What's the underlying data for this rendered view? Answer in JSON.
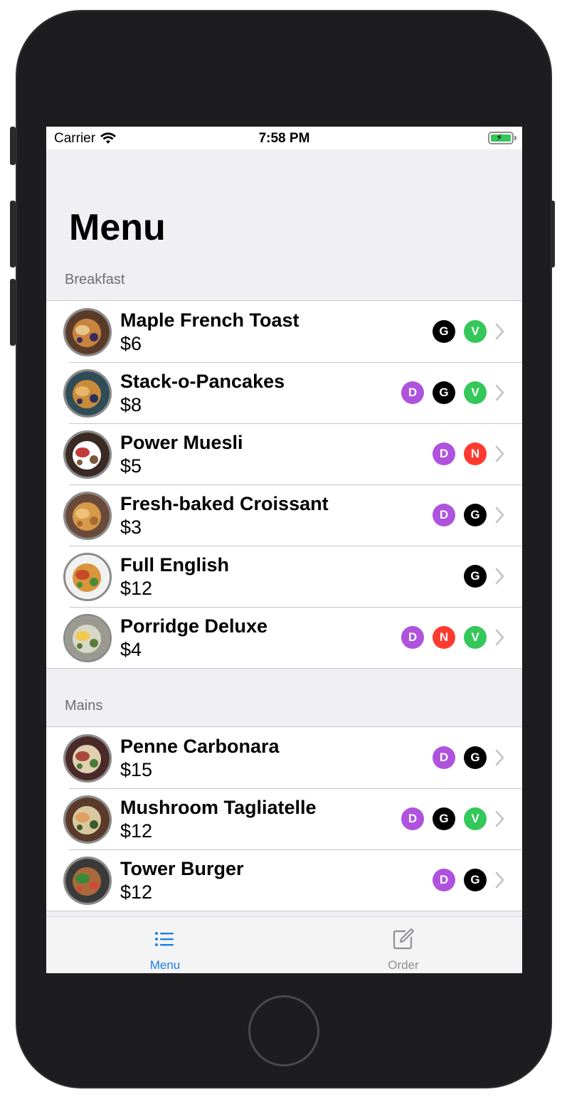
{
  "status_bar": {
    "carrier": "Carrier",
    "time": "7:58 PM"
  },
  "title": "Menu",
  "colors": {
    "accent": "#1a7fe8",
    "tag_D": "#af52de",
    "tag_G": "#000000",
    "tag_N": "#ff3b30",
    "tag_V": "#34c759"
  },
  "sections": [
    {
      "header": "Breakfast",
      "items": [
        {
          "name": "Maple French Toast",
          "price": "$6",
          "tags": [
            "G",
            "V"
          ]
        },
        {
          "name": "Stack-o-Pancakes",
          "price": "$8",
          "tags": [
            "D",
            "G",
            "V"
          ]
        },
        {
          "name": "Power Muesli",
          "price": "$5",
          "tags": [
            "D",
            "N"
          ]
        },
        {
          "name": "Fresh-baked Croissant",
          "price": "$3",
          "tags": [
            "D",
            "G"
          ]
        },
        {
          "name": "Full English",
          "price": "$12",
          "tags": [
            "G"
          ]
        },
        {
          "name": "Porridge Deluxe",
          "price": "$4",
          "tags": [
            "D",
            "N",
            "V"
          ]
        }
      ]
    },
    {
      "header": "Mains",
      "items": [
        {
          "name": "Penne Carbonara",
          "price": "$15",
          "tags": [
            "D",
            "G"
          ]
        },
        {
          "name": "Mushroom Tagliatelle",
          "price": "$12",
          "tags": [
            "D",
            "G",
            "V"
          ]
        },
        {
          "name": "Tower Burger",
          "price": "$12",
          "tags": [
            "D",
            "G"
          ]
        }
      ]
    }
  ],
  "tab_bar": {
    "tabs": [
      {
        "label": "Menu",
        "icon": "list-icon",
        "selected": true
      },
      {
        "label": "Order",
        "icon": "compose-icon",
        "selected": false
      }
    ]
  }
}
